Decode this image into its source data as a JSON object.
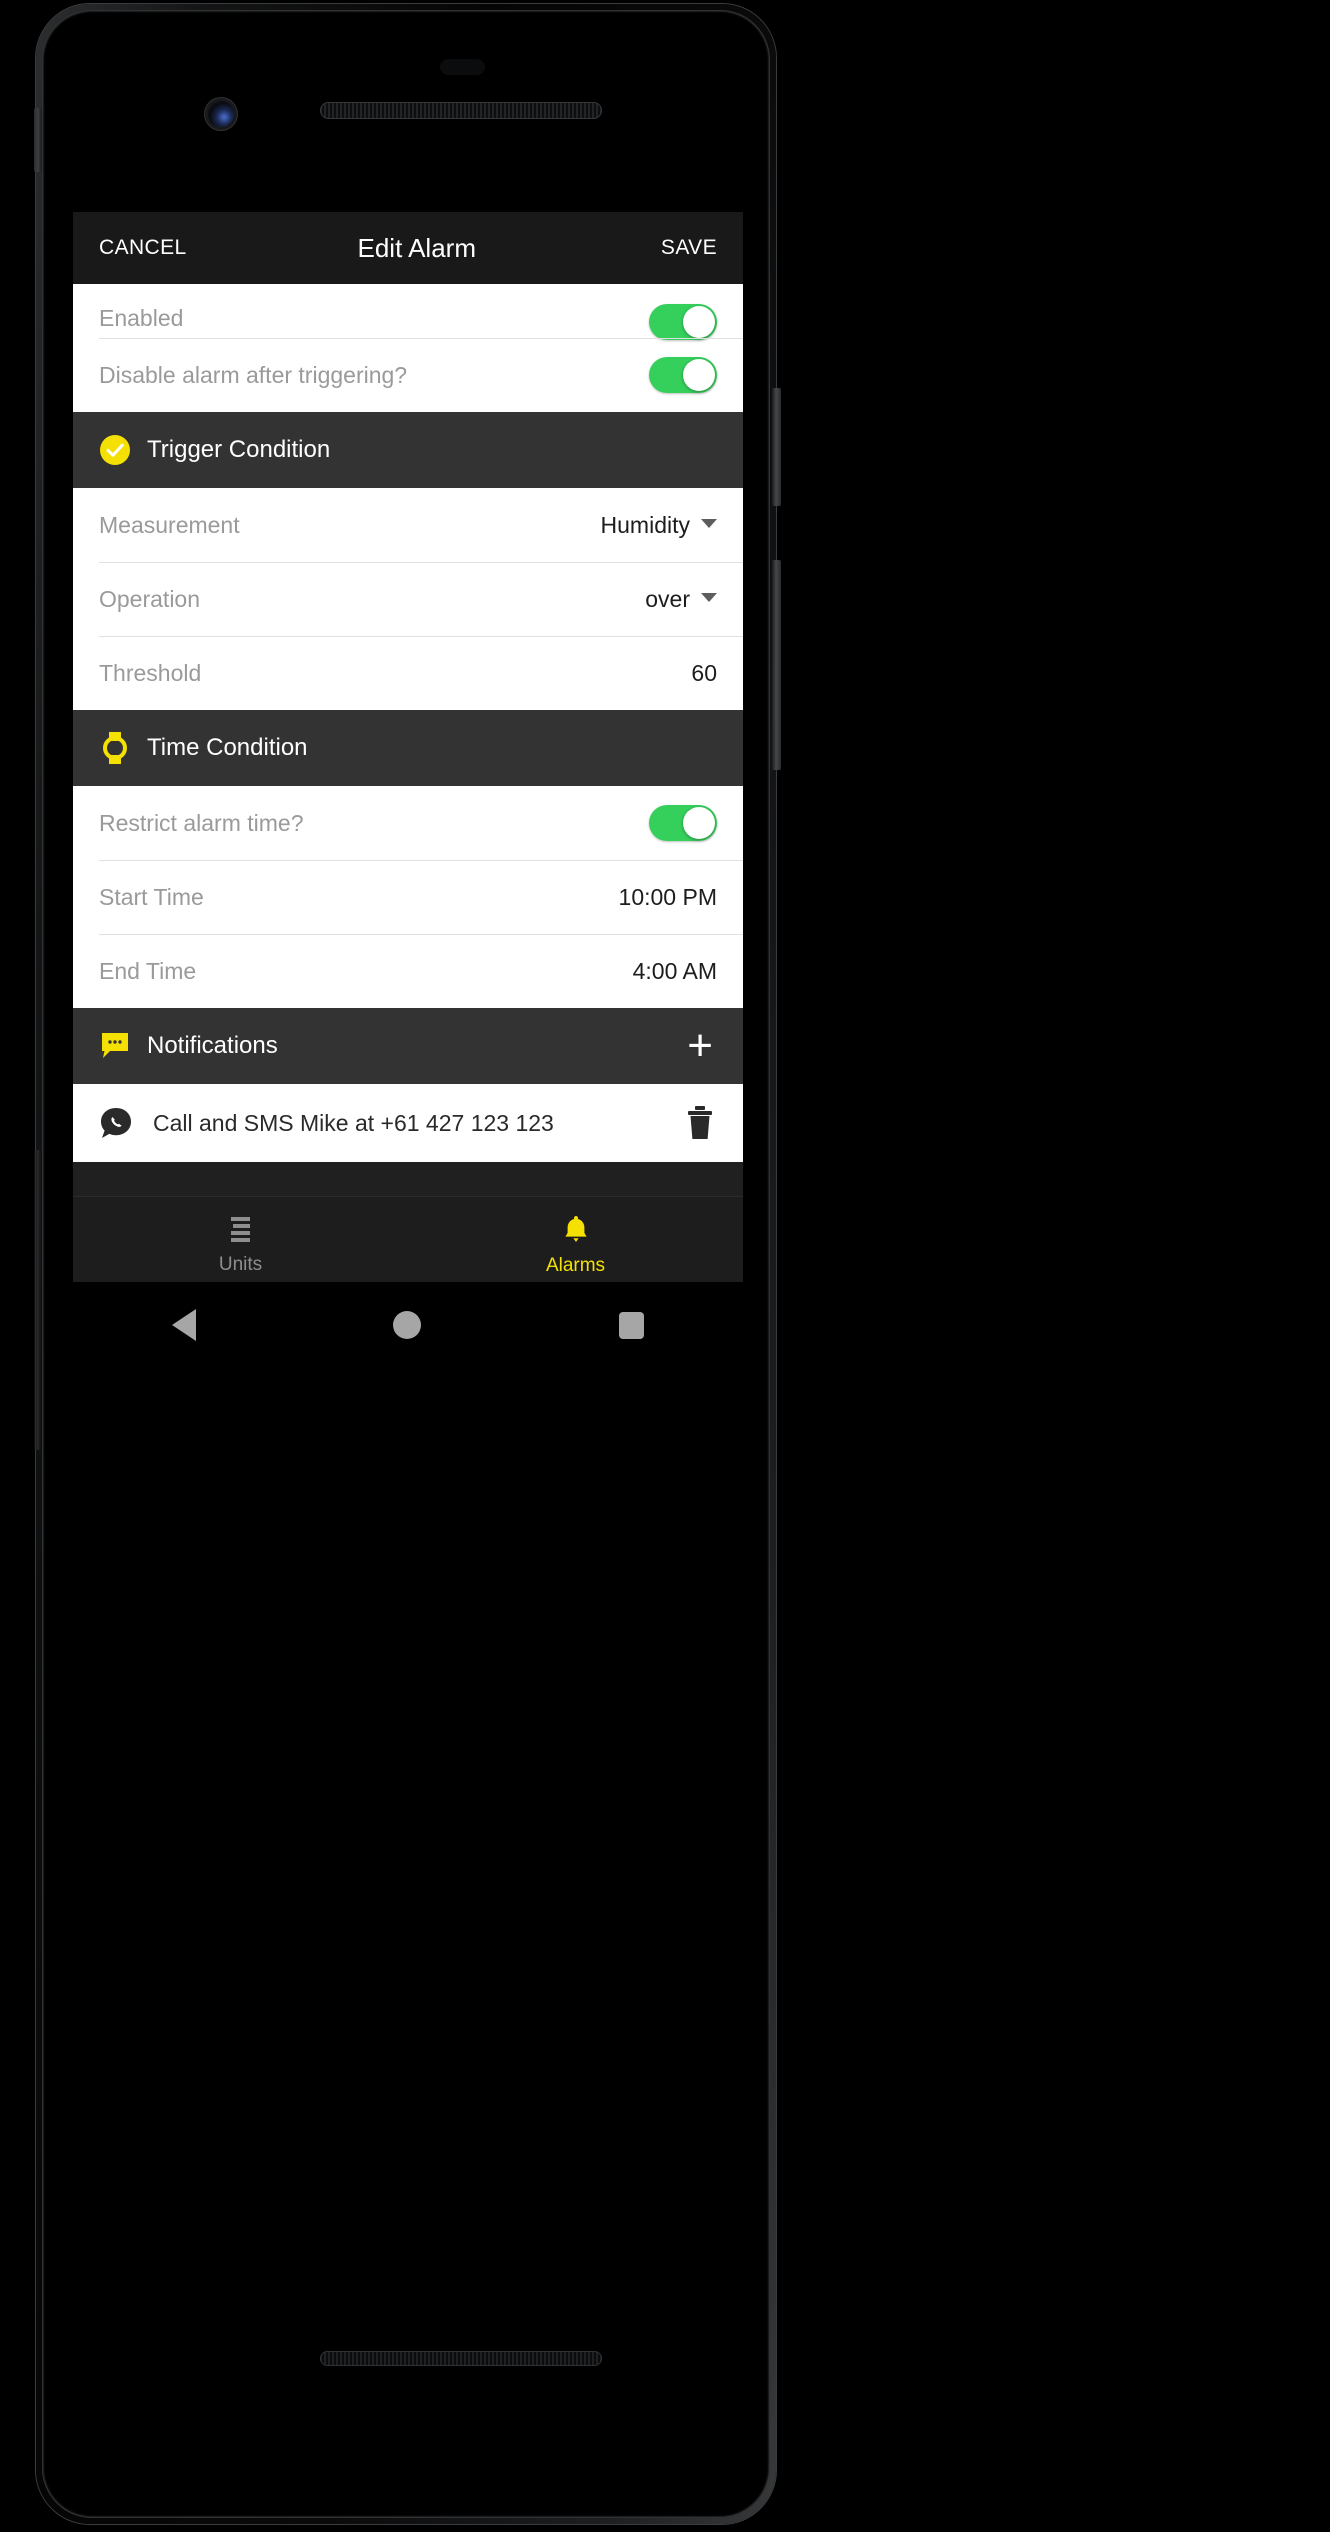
{
  "app_bar": {
    "cancel_label": "CANCEL",
    "title": "Edit Alarm",
    "save_label": "SAVE"
  },
  "general": {
    "rows": [
      {
        "label": "Enabled",
        "toggle": "on"
      },
      {
        "label": "Disable alarm after triggering?",
        "toggle": "on"
      }
    ]
  },
  "trigger_condition": {
    "header": "Trigger Condition",
    "icon": "check-circle-icon",
    "icon_color": "#f5e003",
    "rows": [
      {
        "label": "Measurement",
        "value": "Humidity",
        "control": "dropdown"
      },
      {
        "label": "Operation",
        "value": "over",
        "control": "dropdown"
      },
      {
        "label": "Threshold",
        "value": "60",
        "control": "text"
      }
    ]
  },
  "time_condition": {
    "header": "Time Condition",
    "icon": "watch-icon",
    "icon_color": "#f5e003",
    "rows": [
      {
        "label": "Restrict alarm time?",
        "toggle": "on"
      },
      {
        "label": "Start Time",
        "value": "10:00 PM",
        "control": "time"
      },
      {
        "label": "End Time",
        "value": "4:00 AM",
        "control": "time"
      }
    ]
  },
  "notifications": {
    "header": "Notifications",
    "icon": "speech-bubble-icon",
    "icon_color": "#f5e003",
    "add_label": "+",
    "items": [
      {
        "icon": "phone-bubble-icon",
        "text": "Call and SMS Mike at +61 427 123 123",
        "delete_icon": "trash-icon"
      }
    ]
  },
  "bottom_nav": {
    "tabs": [
      {
        "label": "Units",
        "icon": "list-icon",
        "active": false
      },
      {
        "label": "Alarms",
        "icon": "bell-icon",
        "active": true
      }
    ],
    "active_color": "#f5e003",
    "inactive_color": "#8e8e8e"
  },
  "system_nav": {
    "back": "back-icon",
    "home": "home-icon",
    "recents": "recents-icon"
  },
  "theme": {
    "accent": "#f5e003",
    "toggle_on": "#35cf5c",
    "app_bar_bg": "#191919",
    "section_bg": "#333333",
    "card_bg": "#ffffff"
  }
}
